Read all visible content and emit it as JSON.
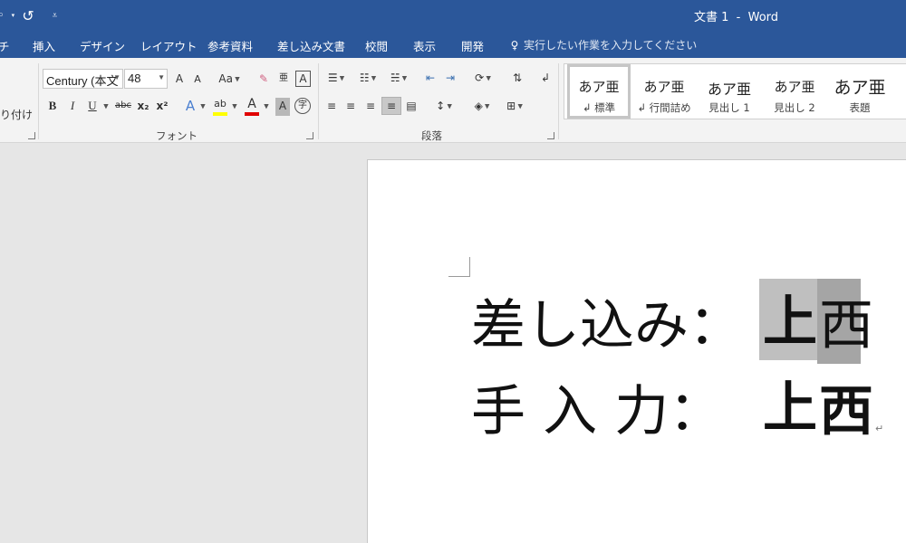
{
  "titlebar": {
    "qat_redo": "↺",
    "qat_more": "⁼",
    "doc_title": "文書 1  -  Word"
  },
  "tabs": [
    {
      "label": "チ"
    },
    {
      "label": "挿入"
    },
    {
      "label": "デザイン"
    },
    {
      "label": "レイアウト"
    },
    {
      "label": "参考資料"
    },
    {
      "label": "差し込み文書"
    },
    {
      "label": "校閲"
    },
    {
      "label": "表示"
    },
    {
      "label": "開発"
    }
  ],
  "tell_me": "実行したい作業を入力してください",
  "ribbon": {
    "clipboard_partial": "り付け",
    "font": {
      "name": "Century (本文",
      "size": "48",
      "group_label": "フォント",
      "grow": "A",
      "shrink": "A",
      "case": "Aa",
      "bold": "B",
      "italic": "I",
      "underline": "U",
      "strike": "abc",
      "sub": "x₂",
      "sup": "x²",
      "text_effect": "A",
      "highlight": "ab",
      "font_color": "A",
      "char_shading": "A",
      "enclose": "字"
    },
    "paragraph": {
      "group_label": "段落"
    },
    "styles": [
      {
        "sample": "あア亜",
        "name": "↲ 標準"
      },
      {
        "sample": "あア亜",
        "name": "↲ 行間詰め"
      },
      {
        "sample": "あア亜",
        "name": "見出し 1"
      },
      {
        "sample": "あア亜",
        "name": "見出し 2"
      },
      {
        "sample": "あア亜",
        "name": "表題"
      }
    ]
  },
  "document": {
    "line1_label": "差し込み：",
    "line1_kanji1": "上",
    "line1_kanji2": "西",
    "line2_label": "手  入  力：",
    "line2_kanji1": "上",
    "line2_kanji2": "西",
    "para_mark": "↵"
  },
  "colors": {
    "title_bar": "#2b579a",
    "highlight_light": "#bfbfbf",
    "highlight_dark": "#a5a5a5",
    "font_color_bar": "#e00000",
    "highlight_bar": "#ffff00"
  }
}
